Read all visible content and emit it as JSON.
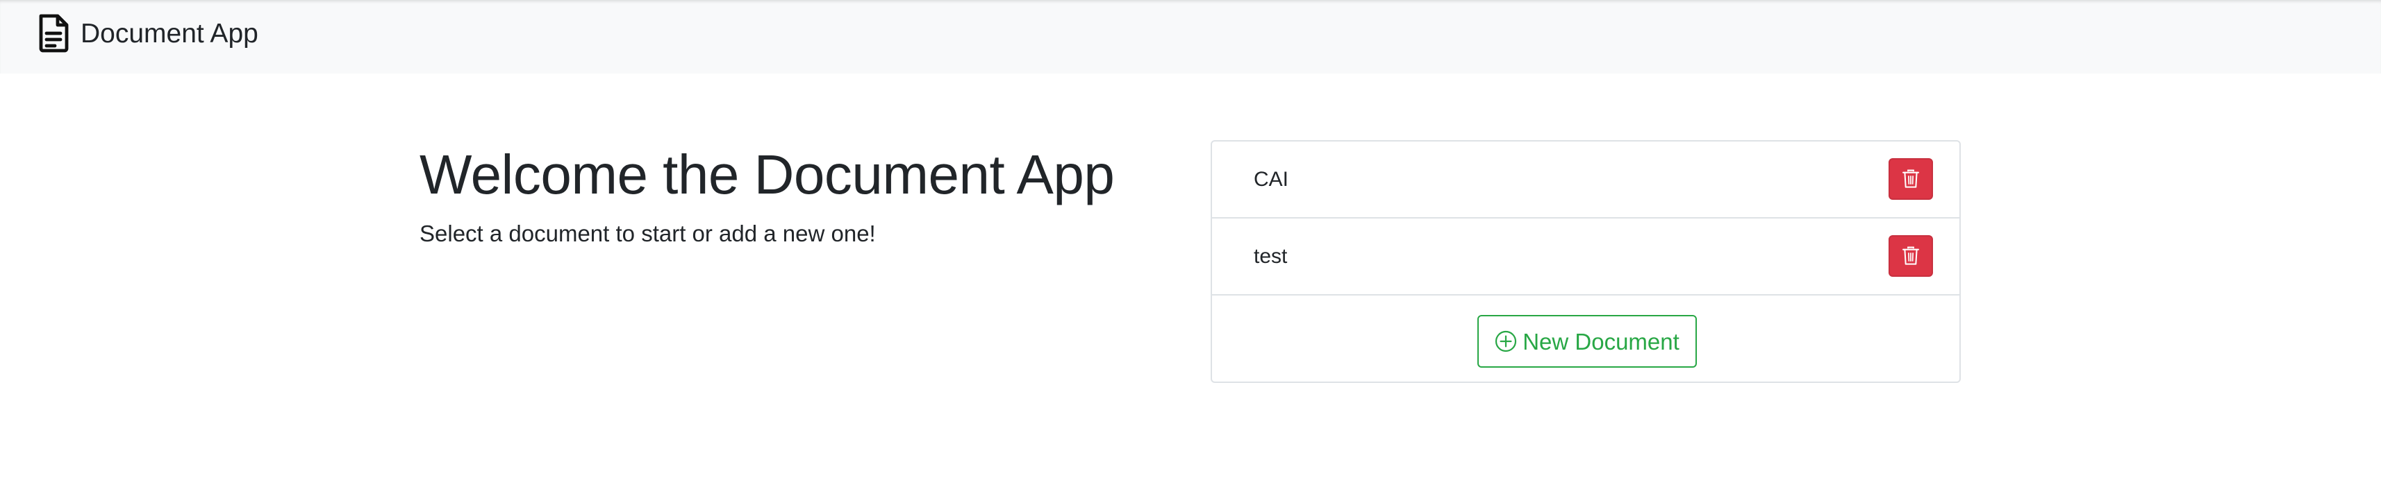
{
  "navbar": {
    "brand_icon": "file-text-icon",
    "brand_label": "Document App"
  },
  "welcome": {
    "title": "Welcome the Document App",
    "subtitle": "Select a document to start or add a new one!"
  },
  "documents": {
    "items": [
      {
        "name": "CAI",
        "delete_icon": "trash-icon"
      },
      {
        "name": "test",
        "delete_icon": "trash-icon"
      }
    ],
    "new_button": {
      "icon": "plus-circle-icon",
      "label": "New Document"
    }
  },
  "colors": {
    "navbar_bg": "#f8f9fa",
    "danger": "#dc3545",
    "success": "#28a745",
    "border": "#dee2e6",
    "text": "#212529"
  }
}
